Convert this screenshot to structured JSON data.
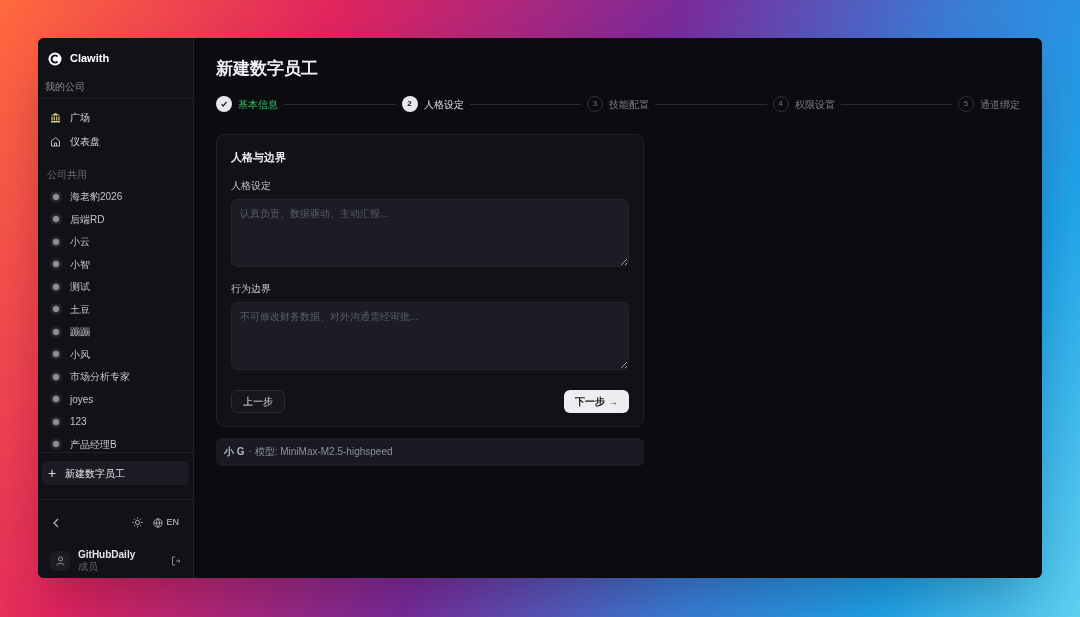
{
  "app": {
    "name": "Clawith",
    "company_label": "我的公司"
  },
  "nav": [
    {
      "kind": "plaza",
      "label": "广场"
    },
    {
      "kind": "dashboard",
      "label": "仪表盘"
    }
  ],
  "section_label": "公司共用",
  "agents": [
    "海老豹2026",
    "后端RD",
    "小云",
    "小智",
    "测试",
    "土豆",
    "蹦蹦",
    "小风",
    "市场分析专家",
    "joyes",
    "123",
    "产品经理B"
  ],
  "new_agent_button": {
    "icon": "+",
    "label": "新建数字员工"
  },
  "footer": {
    "language": "EN",
    "user": {
      "name": "GitHubDaily",
      "role": "成员"
    }
  },
  "page_title": "新建数字员工",
  "steps": [
    {
      "label": "基本信息",
      "completed": true,
      "selected": false
    },
    {
      "number": "2",
      "label": "人格设定",
      "completed": false,
      "selected": true
    },
    {
      "number": "3",
      "label": "技能配置",
      "completed": false,
      "selected": false
    },
    {
      "number": "4",
      "label": "权限设置",
      "completed": false,
      "selected": false
    },
    {
      "number": "5",
      "label": "通道绑定",
      "completed": false,
      "selected": false
    }
  ],
  "card": {
    "title": "人格与边界",
    "fields": [
      {
        "label": "人格设定",
        "placeholder": "认真负责、数据驱动、主动汇报..."
      },
      {
        "label": "行为边界",
        "placeholder": "不可修改财务数据、对外沟通需经审批..."
      }
    ],
    "back_button": "上一步",
    "next_button": "下一步 →"
  },
  "summary": {
    "agent": "小 G",
    "model": "· 模型: MiniMax-M2.5-highspeed"
  }
}
